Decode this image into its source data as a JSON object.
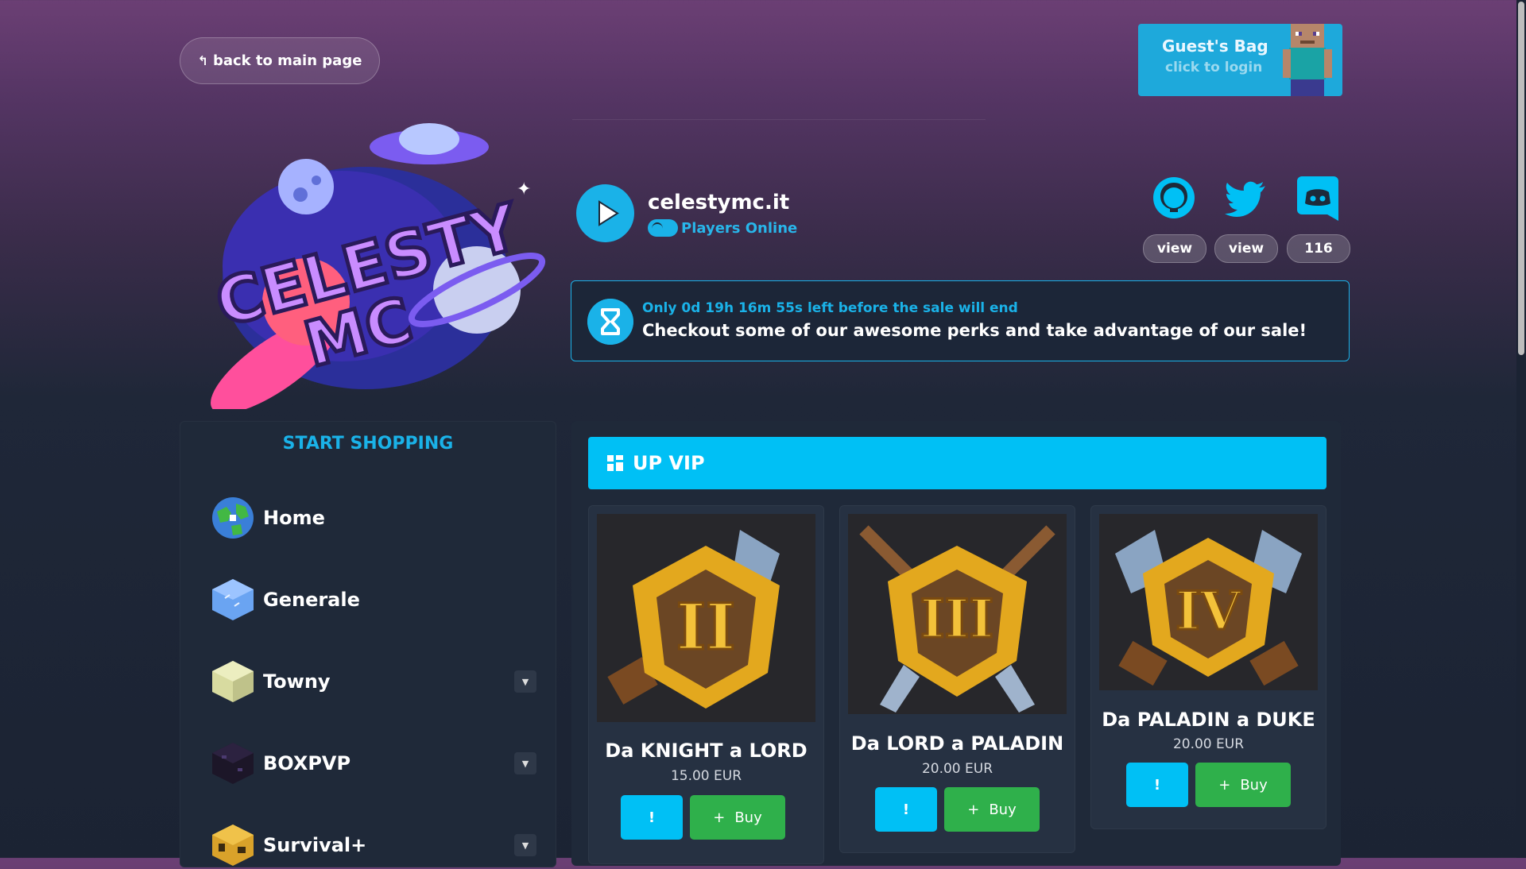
{
  "header": {
    "back_label": "back to main page",
    "guest_bag_title": "Guest's Bag",
    "guest_bag_sub": "click to login"
  },
  "logo": {
    "line1": "CELESTY",
    "line2": "MC"
  },
  "server": {
    "name": "celestymc.it",
    "players_label": "Players Online"
  },
  "social": {
    "github_label": "view",
    "twitter_label": "view",
    "discord_count": "116"
  },
  "sale": {
    "countdown": "Only 0d 19h 16m 55s left before the sale will end",
    "message": "Checkout some of our awesome perks and take advantage of our sale!"
  },
  "sidebar": {
    "title": "START SHOPPING",
    "items": [
      {
        "label": "Home",
        "icon": "globe-icon",
        "has_dropdown": false
      },
      {
        "label": "Generale",
        "icon": "ice-block-icon",
        "has_dropdown": false
      },
      {
        "label": "Towny",
        "icon": "endstone-block-icon",
        "has_dropdown": true
      },
      {
        "label": "BOXPVP",
        "icon": "obsidian-block-icon",
        "has_dropdown": true
      },
      {
        "label": "Survival+",
        "icon": "beehive-block-icon",
        "has_dropdown": true
      }
    ]
  },
  "category": {
    "title": "UP VIP"
  },
  "products": [
    {
      "name": "Da KNIGHT a LORD",
      "price": "15.00 EUR",
      "rank": "II",
      "info_label": "!",
      "buy_label": "Buy"
    },
    {
      "name": "Da LORD a PALADIN",
      "price": "20.00 EUR",
      "rank": "III",
      "info_label": "!",
      "buy_label": "Buy"
    },
    {
      "name": "Da PALADIN a DUKE",
      "price": "20.00 EUR",
      "rank": "IV",
      "info_label": "!",
      "buy_label": "Buy"
    }
  ],
  "colors": {
    "accent": "#00c0f5",
    "buy": "#2fb04b",
    "panel": "#1f2939"
  }
}
